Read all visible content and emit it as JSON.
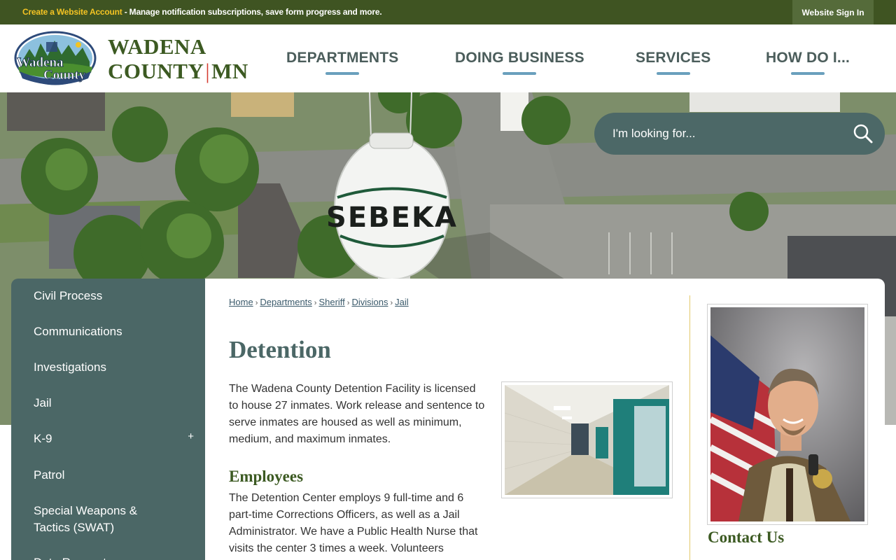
{
  "topbar": {
    "create_link": "Create a Website Account",
    "message": " - Manage notification subscriptions, save form progress and more.",
    "signin": "Website Sign In"
  },
  "header": {
    "logo_line1": "Wadena",
    "logo_line2": "County",
    "brand_line1": "WADENA",
    "brand_county": "COUNTY",
    "brand_bar": "|",
    "brand_state": "MN",
    "nav": [
      "DEPARTMENTS",
      "DOING BUSINESS",
      "SERVICES",
      "HOW DO I..."
    ]
  },
  "hero": {
    "tower_text": "SEBEKA"
  },
  "search": {
    "placeholder": "I'm looking for..."
  },
  "sidebar": {
    "items": [
      {
        "label": "Civil Process"
      },
      {
        "label": "Communications"
      },
      {
        "label": "Investigations"
      },
      {
        "label": "Jail"
      },
      {
        "label": "K-9",
        "expand": "+"
      },
      {
        "label": "Patrol"
      },
      {
        "label": "Special Weapons & Tactics (SWAT)"
      },
      {
        "label": "Data Requests"
      }
    ]
  },
  "breadcrumb": {
    "items": [
      "Home",
      "Departments",
      "Sheriff",
      "Divisions",
      "Jail"
    ],
    "separator": "›"
  },
  "main": {
    "title": "Detention",
    "intro": "The Wadena County Detention Facility is licensed to house 27 inmates. Work release and sentence to serve inmates are housed as well as minimum, medium, and maximum inmates.",
    "employees_heading": "Employees",
    "employees_text": "The Detention Center employs 9 full-time and 6 part-time Corrections Officers, as well as a Jail Administrator. We have a Public Health Nurse that visits the center 3 times a week. Volunteers"
  },
  "aside": {
    "contact_heading": "Contact Us"
  },
  "colors": {
    "topbar": "#3f5422",
    "accent_yellow": "#f3c323",
    "sidebar": "#4b6766",
    "nav_text": "#4b5d5b",
    "nav_underline": "#6aa0bd",
    "heading_green": "#3c5a22"
  }
}
